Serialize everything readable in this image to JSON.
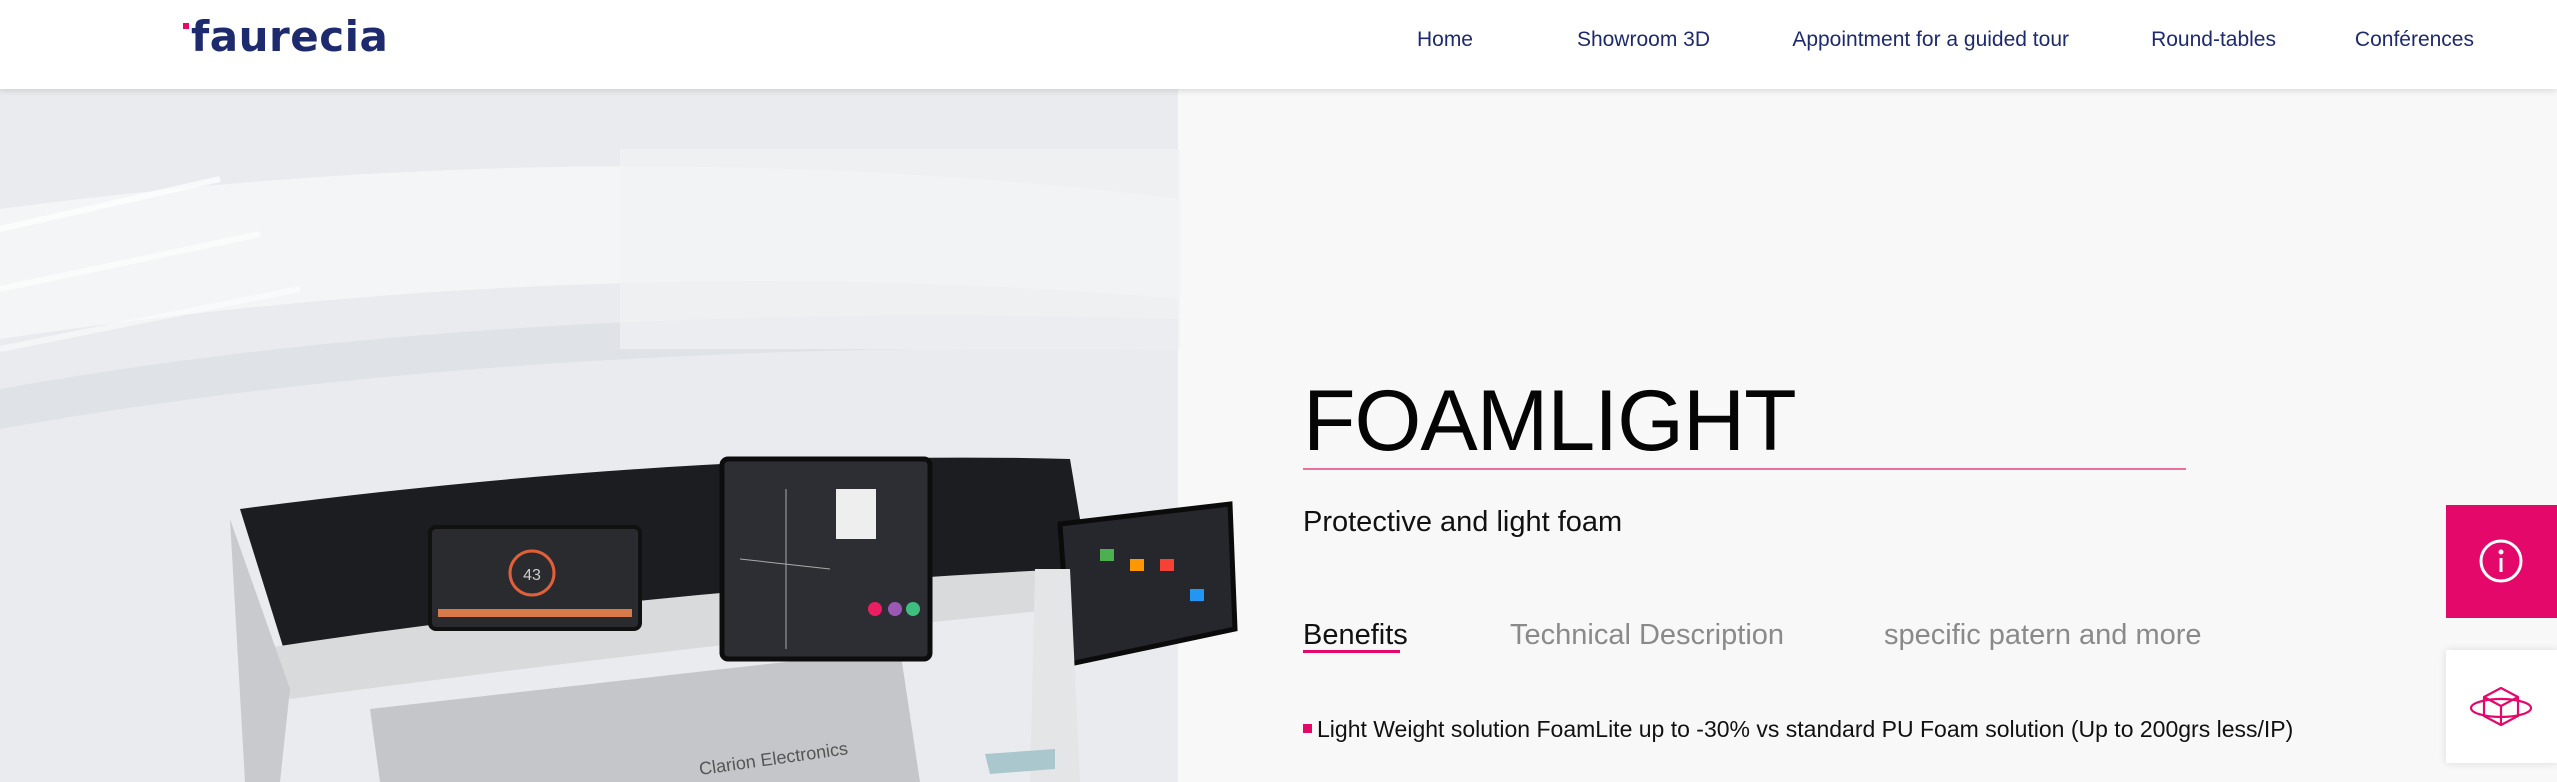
{
  "brand": {
    "logo_text": "faurecia"
  },
  "nav": {
    "items": [
      {
        "label": "Home"
      },
      {
        "label": "Showroom 3D"
      },
      {
        "label": "Appointment for a guided tour"
      },
      {
        "label": "Round-tables"
      },
      {
        "label": "Conférences"
      }
    ]
  },
  "hero": {
    "cockpit_label": "Clarion Electronics",
    "gauge_value": "43"
  },
  "product": {
    "title": "FOAMLIGHT",
    "subtitle": "Protective and light foam",
    "tabs": [
      {
        "label": "Benefits",
        "active": true
      },
      {
        "label": "Technical Description",
        "active": false
      },
      {
        "label": "specific patern and more",
        "active": false
      }
    ],
    "bullets": [
      "Light Weight solution FoamLite up to -30% vs standard PU Foam solution (Up to 200grs less/IP)"
    ]
  },
  "side_buttons": {
    "info_icon": "info-icon",
    "cube_icon": "3d-cube-icon"
  },
  "colors": {
    "brand_navy": "#1e2a6e",
    "accent_pink": "#e5086b",
    "rule_pink": "#e8729d"
  }
}
